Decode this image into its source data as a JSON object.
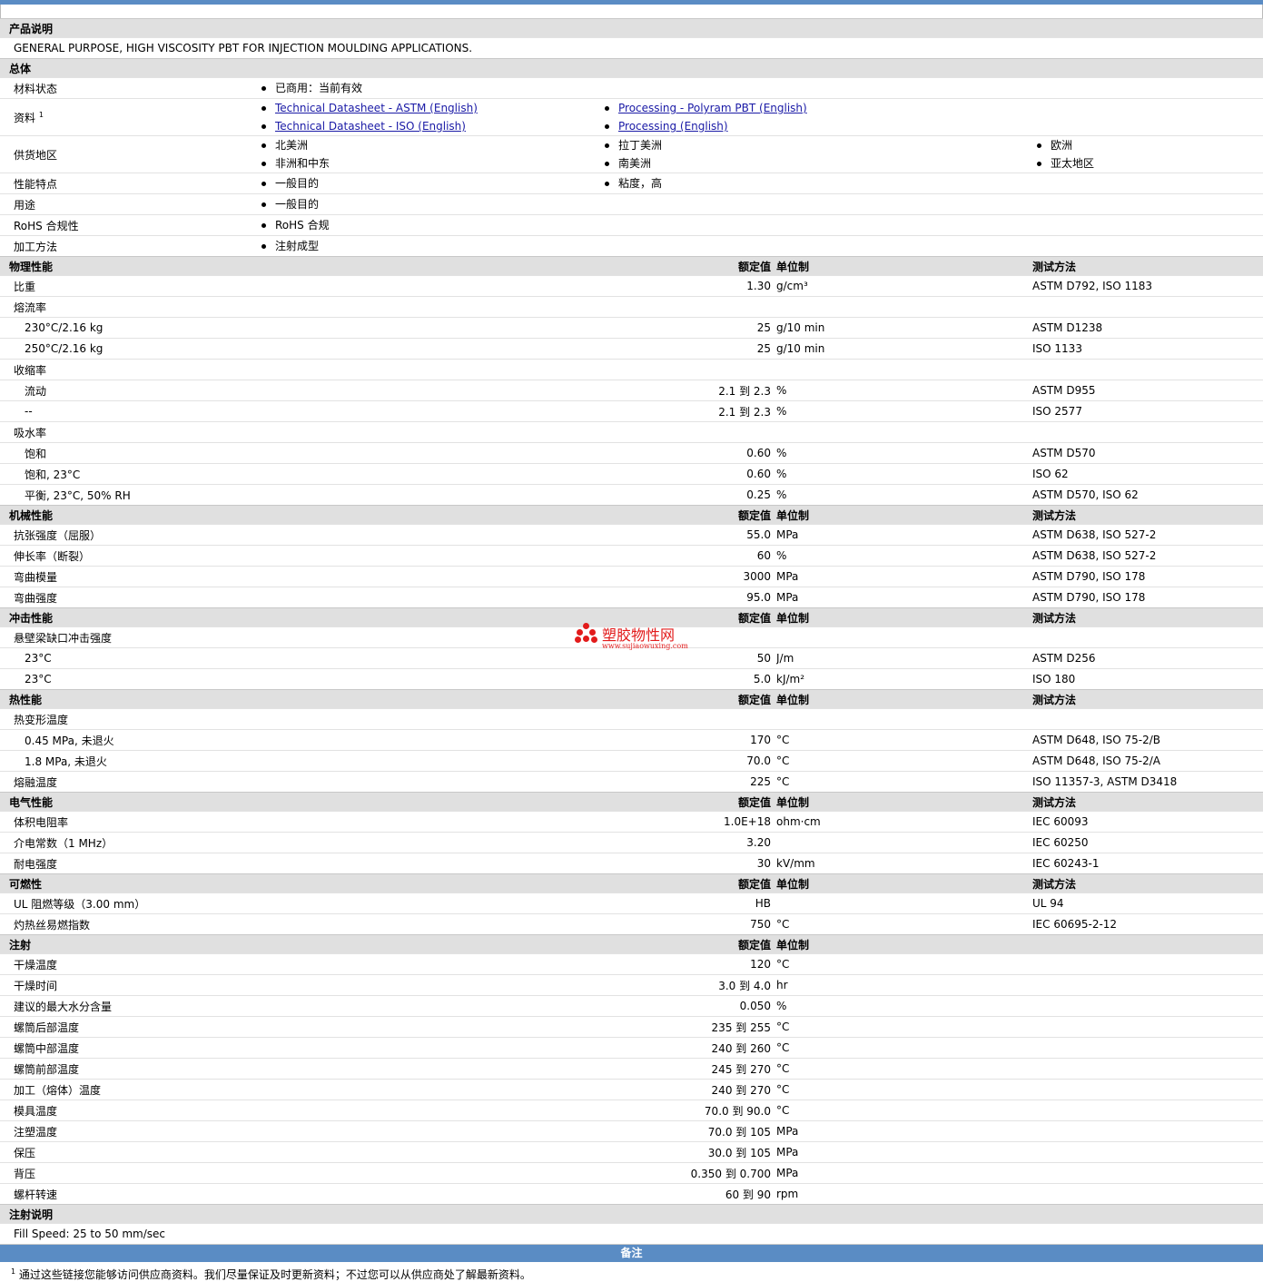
{
  "description": {
    "header": "产品说明",
    "text": "GENERAL PURPOSE, HIGH VISCOSITY PBT FOR INJECTION MOULDING APPLICATIONS."
  },
  "general": {
    "header": "总体",
    "material_status": {
      "label": "材料状态",
      "items": [
        "已商用：当前有效"
      ]
    },
    "documents": {
      "label": "资料",
      "sup": "1",
      "col1": [
        "Technical Datasheet - ASTM (English)",
        "Technical Datasheet - ISO (English)"
      ],
      "col2": [
        "Processing - Polyram PBT (English)",
        "Processing (English)"
      ]
    },
    "availability": {
      "label": "供货地区",
      "col1": [
        "北美洲",
        "非洲和中东"
      ],
      "col2": [
        "拉丁美洲",
        "南美洲"
      ],
      "col3": [
        "欧洲",
        "亚太地区"
      ]
    },
    "features": {
      "label": "性能特点",
      "col1": [
        "一般目的"
      ],
      "col2": [
        "粘度，高"
      ]
    },
    "uses": {
      "label": "用途",
      "col1": [
        "一般目的"
      ]
    },
    "rohs": {
      "label": "RoHS 合规性",
      "col1": [
        "RoHS 合规"
      ]
    },
    "processing": {
      "label": "加工方法",
      "col1": [
        "注射成型"
      ]
    }
  },
  "columns": {
    "value": "额定值",
    "unit": "单位制",
    "test": "测试方法"
  },
  "sections": [
    {
      "title": "物理性能",
      "rows": [
        {
          "label": "比重",
          "value": "1.30",
          "unit": "g/cm³",
          "test": "ASTM D792, ISO 1183"
        },
        {
          "label": "熔流率",
          "value": "",
          "unit": "",
          "test": ""
        },
        {
          "label": "230°C/2.16 kg",
          "value": "25",
          "unit": "g/10 min",
          "test": "ASTM D1238",
          "sub": true
        },
        {
          "label": "250°C/2.16 kg",
          "value": "25",
          "unit": "g/10 min",
          "test": "ISO 1133",
          "sub": true
        },
        {
          "label": "收缩率",
          "value": "",
          "unit": "",
          "test": ""
        },
        {
          "label": "流动",
          "value": "2.1 到  2.3",
          "unit": "%",
          "test": "ASTM D955",
          "sub": true
        },
        {
          "label": "--",
          "value": "2.1 到  2.3",
          "unit": "%",
          "test": "ISO 2577",
          "sub": true
        },
        {
          "label": "吸水率",
          "value": "",
          "unit": "",
          "test": ""
        },
        {
          "label": "饱和",
          "value": "0.60",
          "unit": "%",
          "test": "ASTM D570",
          "sub": true
        },
        {
          "label": "饱和, 23°C",
          "value": "0.60",
          "unit": "%",
          "test": "ISO 62",
          "sub": true
        },
        {
          "label": "平衡, 23°C, 50% RH",
          "value": "0.25",
          "unit": "%",
          "test": "ASTM D570, ISO 62",
          "sub": true
        }
      ]
    },
    {
      "title": "机械性能",
      "rows": [
        {
          "label": "抗张强度（屈服）",
          "value": "55.0",
          "unit": "MPa",
          "test": "ASTM D638, ISO 527-2"
        },
        {
          "label": "伸长率（断裂）",
          "value": "60",
          "unit": "%",
          "test": "ASTM D638, ISO 527-2"
        },
        {
          "label": "弯曲模量",
          "value": "3000",
          "unit": "MPa",
          "test": "ASTM D790, ISO 178"
        },
        {
          "label": "弯曲强度",
          "value": "95.0",
          "unit": "MPa",
          "test": "ASTM D790, ISO 178"
        }
      ]
    },
    {
      "title": "冲击性能",
      "rows": [
        {
          "label": "悬壁梁缺口冲击强度",
          "value": "",
          "unit": "",
          "test": ""
        },
        {
          "label": "23°C",
          "value": "50",
          "unit": "J/m",
          "test": "ASTM D256",
          "sub": true
        },
        {
          "label": "23°C",
          "value": "5.0",
          "unit": "kJ/m²",
          "test": "ISO 180",
          "sub": true
        }
      ]
    },
    {
      "title": "热性能",
      "rows": [
        {
          "label": "热变形温度",
          "value": "",
          "unit": "",
          "test": ""
        },
        {
          "label": "0.45 MPa, 未退火",
          "value": "170",
          "unit": "°C",
          "test": "ASTM D648, ISO 75-2/B",
          "sub": true
        },
        {
          "label": "1.8 MPa, 未退火",
          "value": "70.0",
          "unit": "°C",
          "test": "ASTM D648, ISO 75-2/A",
          "sub": true
        },
        {
          "label": "熔融温度",
          "value": "225",
          "unit": "°C",
          "test": "ISO 11357-3, ASTM D3418"
        }
      ]
    },
    {
      "title": "电气性能",
      "rows": [
        {
          "label": "体积电阻率",
          "value": "1.0E+18",
          "unit": "ohm·cm",
          "test": "IEC 60093"
        },
        {
          "label": "介电常数（1 MHz）",
          "value": "3.20",
          "unit": "",
          "test": "IEC 60250"
        },
        {
          "label": "耐电强度",
          "value": "30",
          "unit": "kV/mm",
          "test": "IEC 60243-1"
        }
      ]
    },
    {
      "title": "可燃性",
      "rows": [
        {
          "label": "UL 阻燃等级（3.00 mm）",
          "value": "HB",
          "unit": "",
          "test": "UL 94"
        },
        {
          "label": "灼热丝易燃指数",
          "value": "750",
          "unit": "°C",
          "test": "IEC 60695-2-12"
        }
      ]
    },
    {
      "title": "注射",
      "noTest": true,
      "rows": [
        {
          "label": "干燥温度",
          "value": "120",
          "unit": "°C",
          "test": ""
        },
        {
          "label": "干燥时间",
          "value": "3.0 到  4.0",
          "unit": "hr",
          "test": ""
        },
        {
          "label": "建议的最大水分含量",
          "value": "0.050",
          "unit": "%",
          "test": ""
        },
        {
          "label": "螺筒后部温度",
          "value": "235 到  255",
          "unit": "°C",
          "test": ""
        },
        {
          "label": "螺筒中部温度",
          "value": "240 到  260",
          "unit": "°C",
          "test": ""
        },
        {
          "label": "螺筒前部温度",
          "value": "245 到  270",
          "unit": "°C",
          "test": ""
        },
        {
          "label": "加工（熔体）温度",
          "value": "240 到  270",
          "unit": "°C",
          "test": ""
        },
        {
          "label": "模具温度",
          "value": "70.0 到  90.0",
          "unit": "°C",
          "test": ""
        },
        {
          "label": "注塑温度",
          "value": "70.0 到  105",
          "unit": "MPa",
          "test": ""
        },
        {
          "label": "保压",
          "value": "30.0 到  105",
          "unit": "MPa",
          "test": ""
        },
        {
          "label": "背压",
          "value": "0.350 到  0.700",
          "unit": "MPa",
          "test": ""
        },
        {
          "label": "螺杆转速",
          "value": "60 到  90",
          "unit": "rpm",
          "test": ""
        }
      ]
    }
  ],
  "injection_notes": {
    "header": "注射说明",
    "text": "Fill Speed: 25 to 50 mm/sec"
  },
  "notes": {
    "header": "备注",
    "sup": "1",
    "text": "通过这些链接您能够访问供应商资料。我们尽量保证及时更新资料；不过您可以从供应商处了解最新资料。"
  },
  "watermark": {
    "name": "塑胶物性网",
    "url": "www.sujiaowuxing.com",
    "color": "#e21b1b"
  }
}
